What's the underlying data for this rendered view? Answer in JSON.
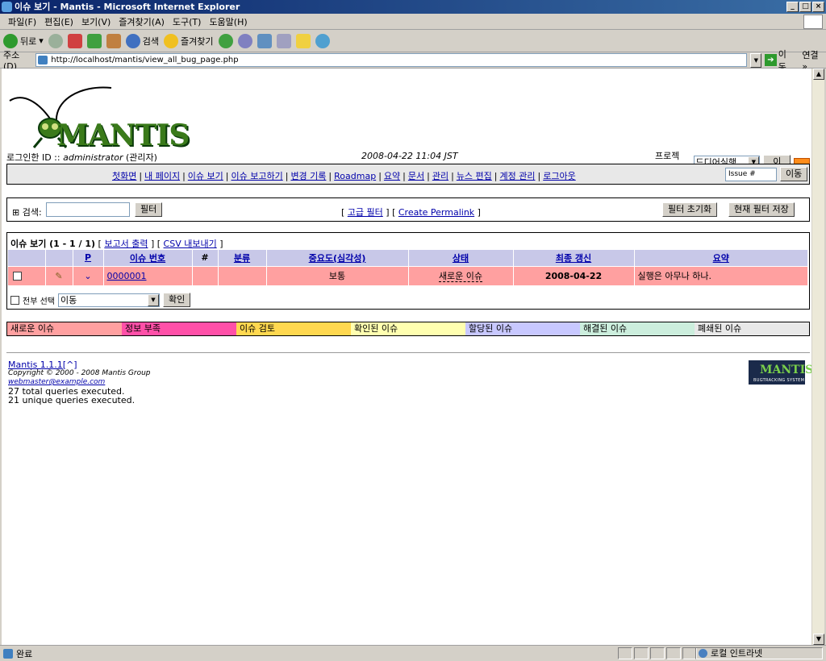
{
  "window": {
    "title": "이슈 보기 - Mantis - Microsoft Internet Explorer",
    "buttons": [
      "_",
      "□",
      "×"
    ]
  },
  "menu": [
    "파일(F)",
    "편집(E)",
    "보기(V)",
    "즐겨찾기(A)",
    "도구(T)",
    "도움말(H)"
  ],
  "toolbar": {
    "back": "뒤로",
    "search": "검색",
    "favorites": "즐겨찾기"
  },
  "address": {
    "label": "주소(D)",
    "url": "http://localhost/mantis/view_all_bug_page.php",
    "go": "이동",
    "links": "연결 »"
  },
  "page": {
    "logo": "MANTIS",
    "login_label": "로그인한 ID :: ",
    "login_user": "administrator",
    "login_role": " (관리자)",
    "datetime": "2008-04-22 11:04 JST",
    "project_label": "프로젝트:",
    "project_value": "드디어실행",
    "project_go": "이동",
    "nav": [
      "첫화면",
      "내 페이지",
      "이슈 보기",
      "이슈 보고하기",
      "변경 기록",
      "Roadmap",
      "요약",
      "문서",
      "관리",
      "뉴스 편집",
      "계정 관리",
      "로그아웃"
    ],
    "issue_jump_placeholder": "Issue #",
    "issue_jump_go": "이동",
    "filter": {
      "search_label": "⊞ 검색:",
      "filter_btn": "필터",
      "advanced": "고급 필터",
      "permalink": "Create Permalink",
      "reset": "필터 초기화",
      "save": "현재 필터 저장"
    },
    "issues": {
      "heading": "이슈 보기 (1 - 1 / 1)",
      "report_link": "보고서 출력",
      "csv_link": "CSV 내보내기",
      "columns": [
        "P",
        "이슈 번호",
        "#",
        "분류",
        "중요도(심각성)",
        "상태",
        "최종 갱신",
        "요약"
      ],
      "rows": [
        {
          "id": "0000001",
          "severity": "보통",
          "status": "새로운 이슈",
          "updated": "2008-04-22",
          "summary": "실행은 아무나 하나."
        }
      ],
      "select_all": "전부 선택",
      "action_value": "이동",
      "confirm": "확인"
    },
    "legend": [
      {
        "label": "새로운 이슈",
        "color": "#ffa0a0"
      },
      {
        "label": "정보 부족",
        "color": "#ff50a8"
      },
      {
        "label": "이슈 검토",
        "color": "#ffd850"
      },
      {
        "label": "확인된 이슈",
        "color": "#ffffb0"
      },
      {
        "label": "할당된 이슈",
        "color": "#c8c8ff"
      },
      {
        "label": "해결된 이슈",
        "color": "#cceedd"
      },
      {
        "label": "폐쇄된 이슈",
        "color": "#e8e8e8"
      }
    ],
    "footer": {
      "version": "Mantis 1.1.1",
      "top_link": "[^]",
      "copyright": "Copyright © 2000 - 2008 Mantis Group",
      "email": "webmaster@example.com",
      "queries_total": "27 total queries executed.",
      "queries_unique": "21 unique queries executed.",
      "badge_title": "MANTIS",
      "badge_sub": "BUGTRACKING SYSTEM"
    }
  },
  "status": {
    "text": "완료",
    "zone": "로컬 인트라넷"
  }
}
